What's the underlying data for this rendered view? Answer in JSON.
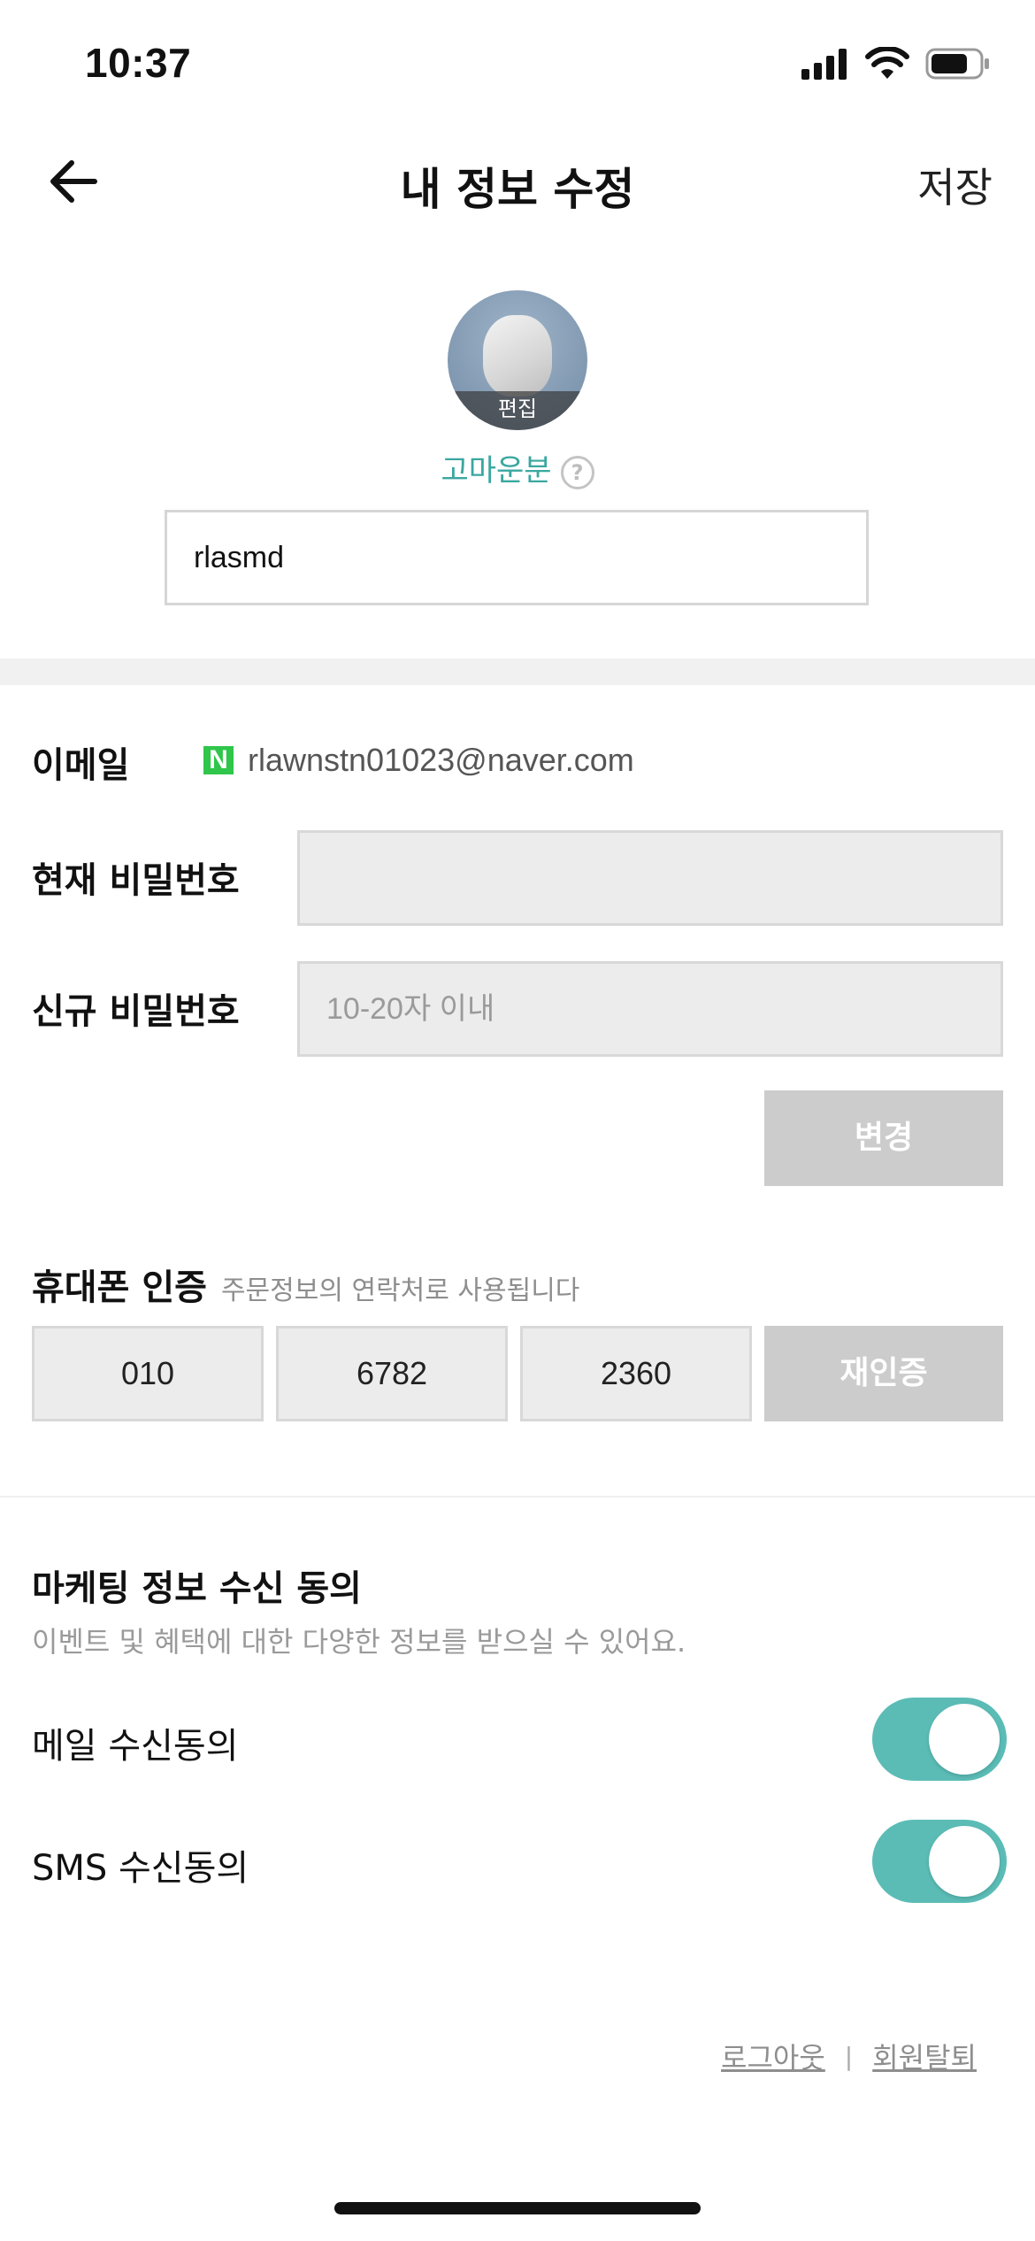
{
  "status_bar": {
    "time": "10:37"
  },
  "nav": {
    "title": "내 정보 수정",
    "save_label": "저장"
  },
  "profile": {
    "edit_label": "편집",
    "nickname_label": "고마운분",
    "help_icon_text": "?",
    "nickname_value": "rlasmd"
  },
  "account": {
    "email_label": "이메일",
    "email_provider_icon": "N",
    "email_value": "rlawnstn01023@naver.com",
    "current_password_label": "현재 비밀번호",
    "new_password_label": "신규 비밀번호",
    "new_password_placeholder": "10-20자 이내",
    "change_button_label": "변경"
  },
  "phone": {
    "label": "휴대폰 인증",
    "hint": "주문정보의 연락처로 사용됩니다",
    "parts": [
      "010",
      "6782",
      "2360"
    ],
    "reverify_label": "재인증"
  },
  "marketing": {
    "title": "마케팅 정보 수신 동의",
    "description": "이벤트 및 혜택에 대한 다양한 정보를 받으실 수 있어요.",
    "email_consent_label": "메일 수신동의",
    "email_consent_on": true,
    "sms_consent_label": "SMS 수신동의",
    "sms_consent_on": true
  },
  "footer": {
    "logout_label": "로그아웃",
    "separator": "|",
    "withdraw_label": "회원탈퇴"
  },
  "colors": {
    "accent_teal": "#5bbcb6",
    "nickname_teal": "#3aa7a0",
    "naver_green": "#2fc64b",
    "disabled_button": "#cccccc"
  }
}
